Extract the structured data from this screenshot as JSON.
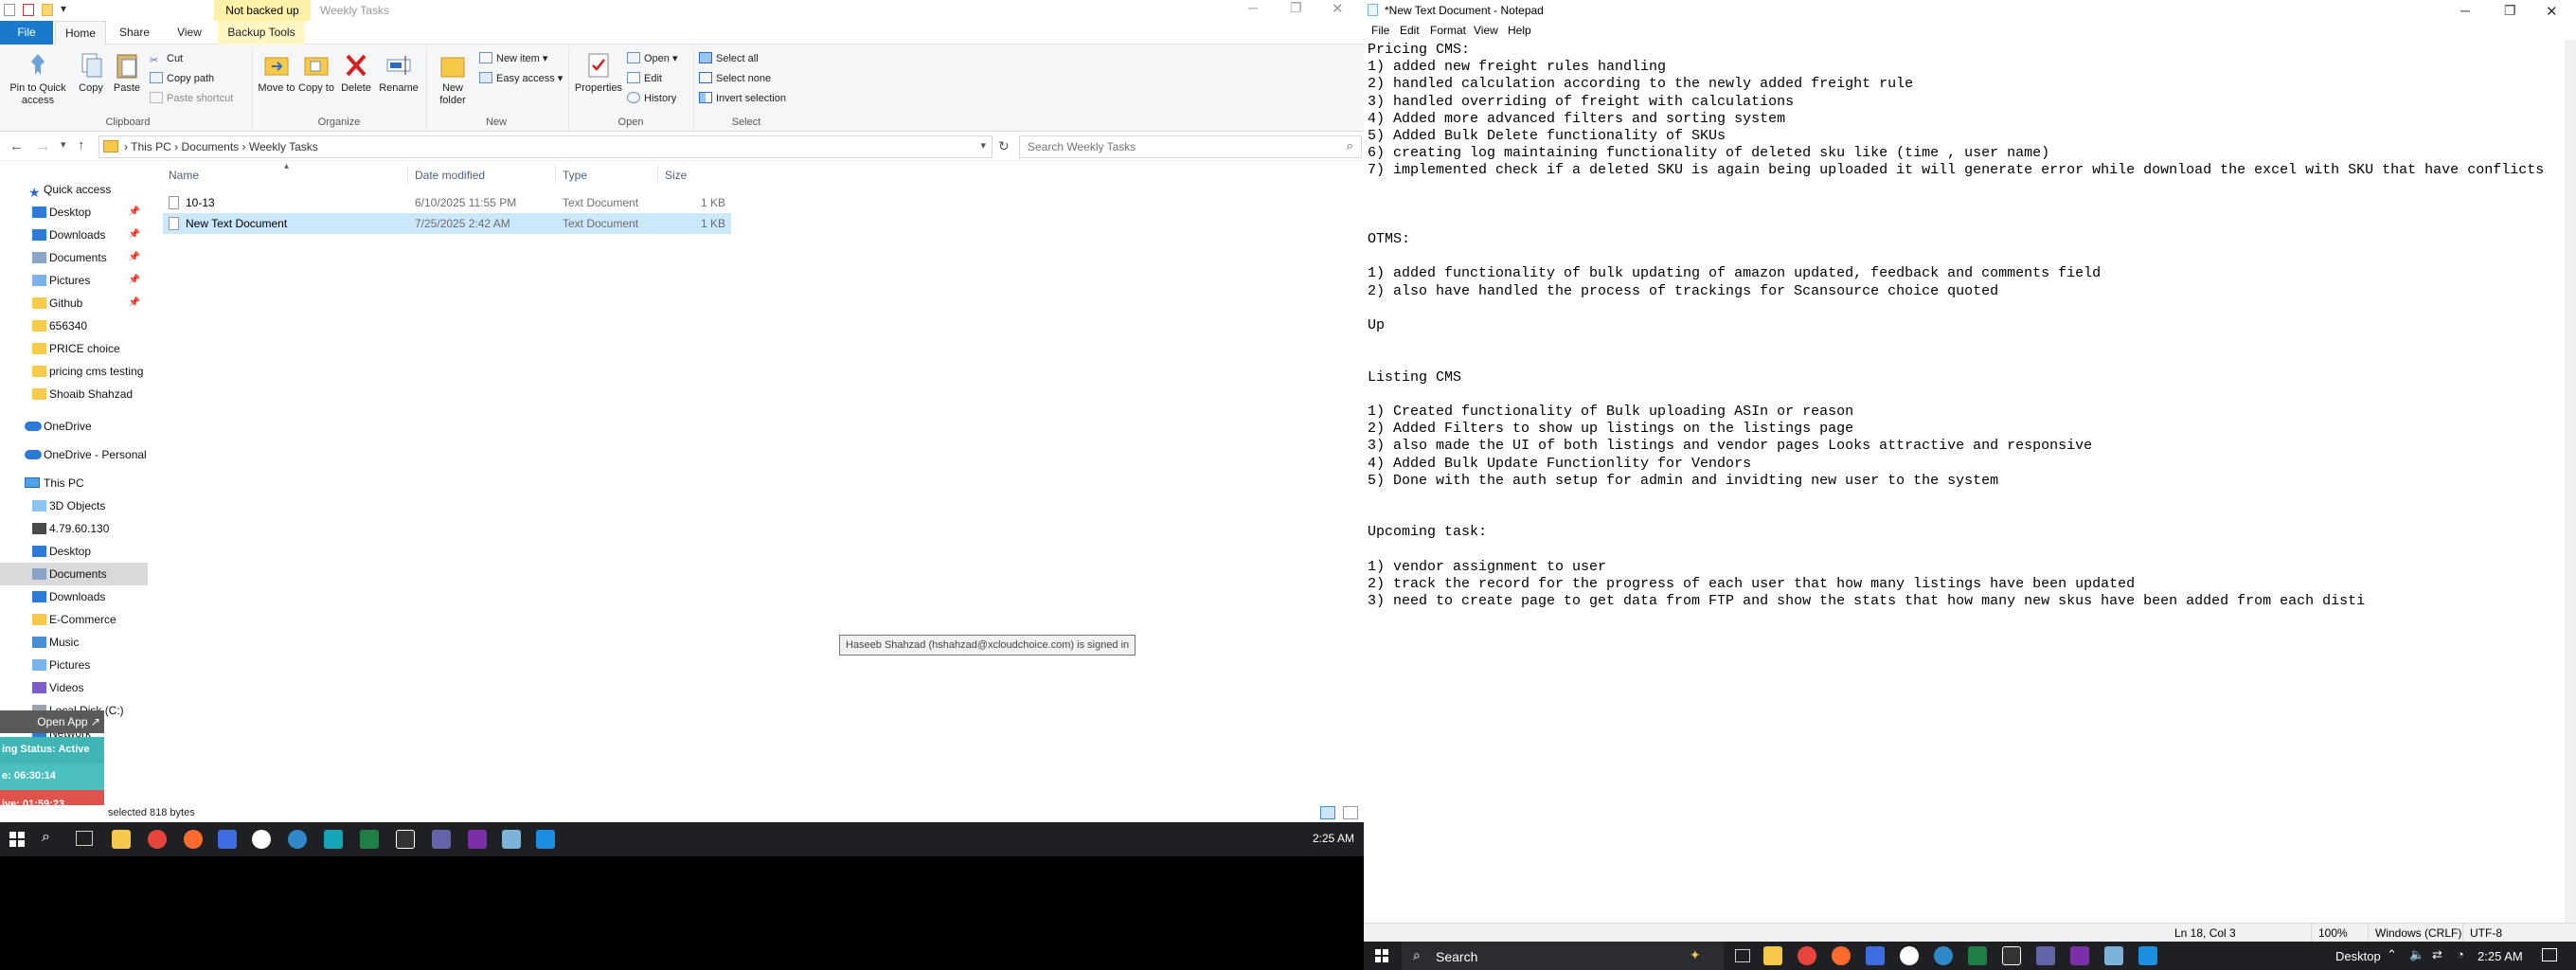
{
  "explorer": {
    "qat_badge": "Not backed up",
    "title": "Weekly Tasks",
    "tabs": [
      "File",
      "Home",
      "Share",
      "View",
      "Backup Tools"
    ],
    "ribbon": {
      "clipboard": {
        "pin": "Pin to Quick access",
        "copy": "Copy",
        "paste": "Paste",
        "cut": "Cut",
        "copy_path": "Copy path",
        "paste_shortcut": "Paste shortcut",
        "label": "Clipboard"
      },
      "organize": {
        "move_to": "Move to",
        "copy_to": "Copy to",
        "delete": "Delete",
        "rename": "Rename",
        "label": "Organize"
      },
      "new": {
        "new_folder": "New folder",
        "new_item": "New item",
        "easy_access": "Easy access",
        "label": "New"
      },
      "open": {
        "properties": "Properties",
        "open": "Open",
        "edit": "Edit",
        "history": "History",
        "label": "Open"
      },
      "select": {
        "select_all": "Select all",
        "select_none": "Select none",
        "invert": "Invert selection",
        "label": "Select"
      }
    },
    "breadcrumb": [
      "This PC",
      "Documents",
      "Weekly Tasks"
    ],
    "search_placeholder": "Search Weekly Tasks",
    "nav": {
      "quick_access": "Quick access",
      "quick_items": [
        "Desktop",
        "Downloads",
        "Documents",
        "Pictures",
        "Github",
        "656340",
        "PRICE choice",
        "pricing cms testing",
        "Shoaib Shahzad"
      ],
      "onedrive": "OneDrive",
      "onedrive_personal": "OneDrive - Personal",
      "this_pc": "This PC",
      "pc_items": [
        "3D Objects",
        "4.79.60.130",
        "Desktop",
        "Documents",
        "Downloads",
        "E-Commerce",
        "Music",
        "Pictures",
        "Videos",
        "Local Disk (C:)",
        "Network"
      ]
    },
    "columns": {
      "name": "Name",
      "date": "Date modified",
      "type": "Type",
      "size": "Size"
    },
    "files": [
      {
        "name": "10-13",
        "date": "6/10/2025 11:55 PM",
        "type": "Text Document",
        "size": "1 KB"
      },
      {
        "name": "New Text Document",
        "date": "7/25/2025 2:42 AM",
        "type": "Text Document",
        "size": "1 KB"
      }
    ],
    "tooltip": "Haseeb Shahzad (hshahzad@xcloudchoice.com) is signed in",
    "status": "selected  818 bytes",
    "overlay": {
      "open_app": "Open App ↗",
      "status_active": "ing Status: Active",
      "timer1": "e: 06:30:14",
      "timer2": "ive: 01:59:23"
    },
    "clock": "2:25 AM",
    "colors": {
      "file_tab": "#1979ca",
      "selected_row": "#cce8ff",
      "overlay_teal": "#3fb6b5",
      "overlay_red": "#e0524c"
    }
  },
  "notepad": {
    "title": "*New Text Document - Notepad",
    "menu": [
      "File",
      "Edit",
      "Format",
      "View",
      "Help"
    ],
    "lines": [
      "Pricing CMS:",
      "1) added new freight rules handling",
      "2) handled calculation according to the newly added freight rule",
      "3) handled overriding of freight with calculations",
      "4) Added more advanced filters and sorting system",
      "5) Added Bulk Delete functionality of SKUs",
      "6) creating log maintaining functionality of deleted sku like (time , user name)",
      "7) implemented check if a deleted SKU is again being uploaded it will generate error while download the excel with SKU that have conflicts",
      "",
      "",
      "",
      "OTMS:",
      "",
      "1) added functionality of bulk updating of amazon updated, feedback and comments field",
      "2) also have handled the process of trackings for Scansource choice quoted",
      "",
      "Up",
      "",
      "",
      "Listing CMS",
      "",
      "1) Created functionality of Bulk uploading ASIn or reason",
      "2) Added Filters to show up listings on the listings page",
      "3) also made the UI of both listings and vendor pages Looks attractive and responsive",
      "4) Added Bulk Update Functionlity for Vendors",
      "5) Done with the auth setup for admin and invidting new user to the system",
      "",
      "",
      "Upcoming task:",
      "",
      "1) vendor assignment to user",
      "2) track the record for the progress of each user that how many listings have been updated",
      "3) need to create page to get data from FTP and show the stats that how many new skus have been added from each disti"
    ],
    "status": {
      "position": "Ln 18, Col 3",
      "zoom": "100%",
      "eol": "Windows (CRLF)",
      "encoding": "UTF-8"
    }
  },
  "taskbar": {
    "search": "Search",
    "desktop": "Desktop",
    "clock": "2:25 AM"
  }
}
